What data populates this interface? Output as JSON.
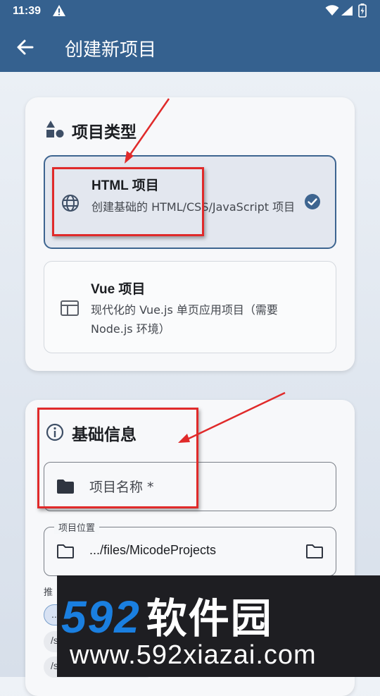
{
  "status_bar": {
    "time": "11:39",
    "icons": [
      "warning-icon",
      "wifi-icon",
      "signal-icon",
      "battery-charging-icon"
    ]
  },
  "app_bar": {
    "title": "创建新项目",
    "back_icon": "arrow-back-icon",
    "background": "#35618f"
  },
  "project_type": {
    "title": "项目类型",
    "icon": "category-shapes-icon",
    "options": [
      {
        "name": "HTML 项目",
        "description": "创建基础的 HTML/CSS/JavaScript 项目",
        "icon": "globe-icon",
        "selected": true
      },
      {
        "name": "Vue 项目",
        "description": "现代化的 Vue.js 单页应用项目（需要 Node.js 环境）",
        "icon": "web-window-icon",
        "selected": false
      }
    ]
  },
  "basic_info": {
    "title": "基础信息",
    "icon": "info-icon",
    "name_field": {
      "placeholder": "项目名称 *",
      "icon": "folder-icon"
    },
    "location_field": {
      "label": "项目位置",
      "value": ".../files/MicodeProjects",
      "left_icon": "folder-outline-icon",
      "right_icon": "folder-browse-icon"
    },
    "recommended_label": "推",
    "chips": [
      "...",
      "/s",
      "/s"
    ]
  },
  "watermark": {
    "brand_number": "592",
    "brand_text": "软件园",
    "url": "www.592xiazai.com"
  },
  "colors": {
    "accent": "#3e6590",
    "annotation_red": "#e02a2a",
    "watermark_blue": "#1a7fe0"
  }
}
